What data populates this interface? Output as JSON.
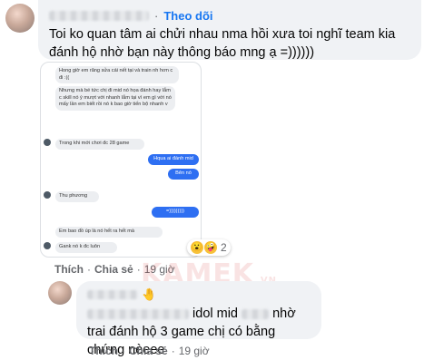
{
  "comment1": {
    "follow_label": "Theo dõi",
    "text": "Toi ko quan tâm ai chửi nhau nma hồi xưa toi nghĩ team kia đánh hộ nhờ bạn này thông báo mng ạ =))))))",
    "like_label": "Thích",
    "share_label": "Chia sẻ",
    "time": "19 giờ",
    "reaction_count": "2",
    "reaction_icons": [
      "wow-emoji",
      "haha-emoji"
    ]
  },
  "chat_screenshot": {
    "messages": [
      {
        "side": "in",
        "text": "Hong giờ em răng sửa cái nết tại và train nh hơn c đi :(("
      },
      {
        "side": "in",
        "text": "Nhưng mà bé tức chị đi mid nó họa đánh hay lắm c skill nó ý mượt với nhanh lắm tại vì em gì với nó mấy lần em biết rồi nó k bao giờ tiến bộ nhanh v"
      },
      {
        "side": "in",
        "text": "Trong khi mới chơi đc 28 game"
      },
      {
        "side": "out",
        "text": "Hqua ai đánh mid"
      },
      {
        "side": "out",
        "text": "Bên nó"
      },
      {
        "side": "in",
        "text": "Thu phương"
      },
      {
        "side": "out",
        "text": "=)))))))))"
      },
      {
        "side": "in",
        "text": "Em bao đồ úp là nó hết ra hết mà"
      },
      {
        "side": "in",
        "text": "Gank nó k đc luôn"
      }
    ]
  },
  "reply1": {
    "text_part1": "idol mid",
    "text_part2": "nhờ trai đánh hộ 3 game chị có bằng chứng nèeee",
    "like_label": "Thích",
    "share_label": "Chia sẻ",
    "time": "19 giờ"
  },
  "watermark": {
    "main": "KAMEK",
    "suffix": ".VN"
  },
  "colors": {
    "link_blue": "#1877f2",
    "bubble_bg": "#f0f2f5",
    "meta_gray": "#65676b",
    "messenger_blue": "#2e6ff2"
  }
}
